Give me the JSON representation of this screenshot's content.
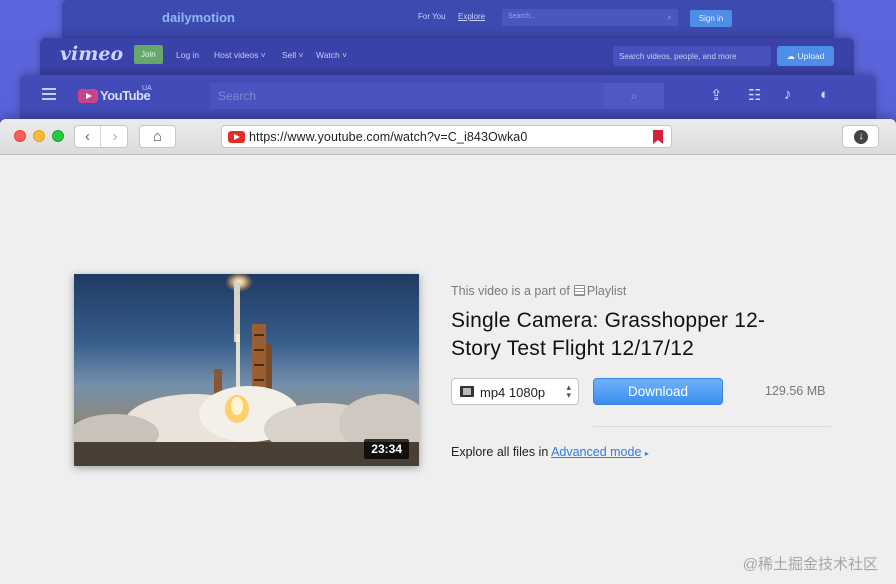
{
  "bg_sites": {
    "dailymotion": {
      "logo": "dailymotion",
      "nav": [
        "For You",
        "Explore"
      ],
      "search_placeholder": "Search...",
      "signin": "Sign in"
    },
    "vimeo": {
      "logo": "vimeo",
      "join": "Join",
      "nav": [
        "Log in",
        "Host videos ˅",
        "Sell ˅",
        "Watch ˅"
      ],
      "search_placeholder": "Search videos, people, and more",
      "upload": "Upload"
    },
    "youtube": {
      "logo": "YouTube",
      "region": "UA",
      "search_placeholder": "Search"
    }
  },
  "browser": {
    "url": "https://www.youtube.com/watch?v=C_i843Owka0"
  },
  "video": {
    "part_of_prefix": "This video is a part of",
    "part_of_link": "Playlist",
    "title": "Single Camera: Grasshopper 12-Story Test Flight 12/17/12",
    "duration": "23:34",
    "format": "mp4 1080p",
    "download_label": "Download",
    "file_size": "129.56 MB",
    "explore_prefix": "Explore all files in",
    "advanced_link": "Advanced mode"
  },
  "watermark": "@稀土掘金技术社区",
  "colors": {
    "accent": "#3c8cf0",
    "link": "#2f7be5",
    "background": "#5159d0"
  }
}
